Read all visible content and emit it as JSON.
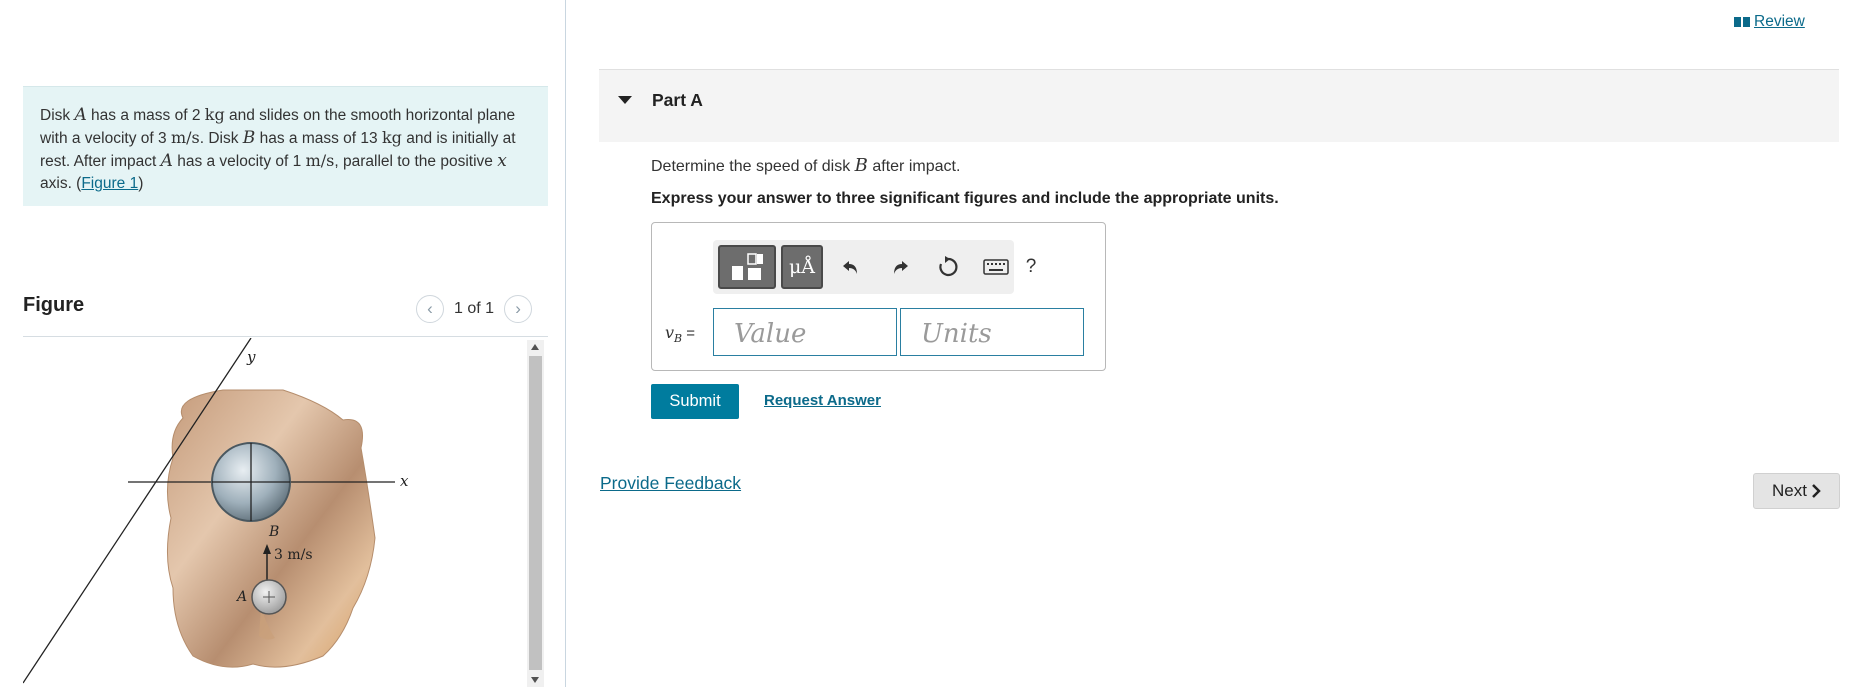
{
  "header": {
    "review_label": "Review"
  },
  "problem": {
    "segments": [
      "Disk ",
      "A",
      " has a mass of 2 ",
      "kg",
      " and slides on the smooth horizontal plane with a velocity of 3 ",
      "m/s",
      ". Disk ",
      "B",
      " has a mass of 13 ",
      "kg",
      " and is initially at rest. After impact ",
      "A",
      " has a velocity of 1 ",
      "m/s",
      ", parallel to the positive ",
      "x",
      " axis. (",
      "Figure 1",
      ")"
    ]
  },
  "figure": {
    "title": "Figure",
    "pager": "1 of 1",
    "prev_icon": "chevron-left-icon",
    "next_icon": "chevron-right-icon",
    "labels": {
      "y_axis": "y",
      "x_axis": "x",
      "disk_b": "B",
      "disk_a": "A",
      "velocity": "3 m/s"
    }
  },
  "part": {
    "title": "Part A",
    "question_pre": "Determine the speed of disk ",
    "question_var": "B",
    "question_post": " after impact.",
    "instruction": "Express your answer to three significant figures and include the appropriate units."
  },
  "answer": {
    "label_var": "v",
    "label_sub": "B",
    "label_eq": " =",
    "value_placeholder": "Value",
    "units_placeholder": "Units",
    "toolbar": {
      "templates_icon": "templates-icon",
      "units_label": "μÅ",
      "undo_icon": "undo-icon",
      "redo_icon": "redo-icon",
      "reset_icon": "reset-icon",
      "keyboard_icon": "keyboard-icon",
      "help_label": "?"
    }
  },
  "actions": {
    "submit_label": "Submit",
    "request_label": "Request Answer",
    "feedback_label": "Provide Feedback",
    "next_label": "Next"
  },
  "colors": {
    "accent": "#007c9e",
    "link": "#0b6a8a",
    "problem_bg": "#e5f4f5"
  }
}
